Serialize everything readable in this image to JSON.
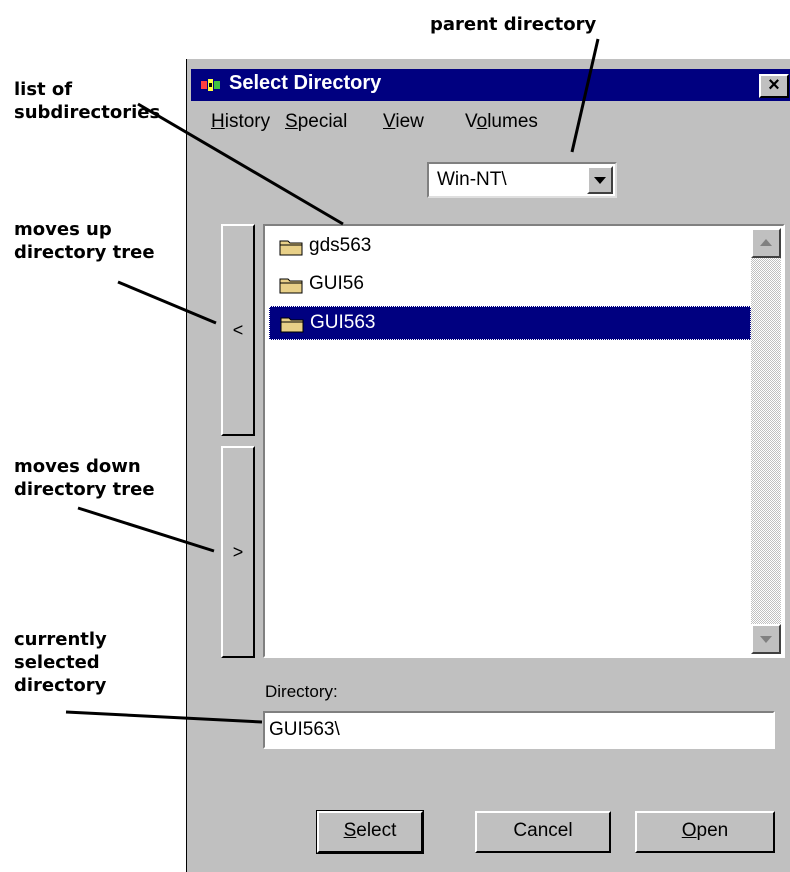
{
  "annotations": {
    "parent_directory": "parent directory",
    "list_of_subdirectories_line1": "list of",
    "list_of_subdirectories_line2": "subdirectories",
    "moves_up_line1": "moves up",
    "moves_up_line2": "directory tree",
    "moves_down_line1": "moves down",
    "moves_down_line2": "directory tree",
    "currently_selected_line1": "currently",
    "currently_selected_line2": "selected",
    "currently_selected_line3": "directory"
  },
  "dialog": {
    "title": "Select Directory",
    "close_label": "×",
    "menu": [
      {
        "underline": "H",
        "rest": "istory"
      },
      {
        "underline": "S",
        "rest": "pecial"
      },
      {
        "underline": "V",
        "rest": "iew"
      },
      {
        "prefix": "V",
        "underline": "o",
        "rest": "lumes"
      }
    ],
    "parent_select_value": "Win-NT\\",
    "up_button_label": "<",
    "down_button_label": ">",
    "directories": [
      {
        "name": "gds563",
        "selected": false
      },
      {
        "name": "GUI56",
        "selected": false
      },
      {
        "name": "GUI563",
        "selected": true
      }
    ],
    "directory_label": "Directory:",
    "directory_value": "GUI563\\",
    "buttons": {
      "select": {
        "underline": "S",
        "rest": "elect"
      },
      "cancel": "Cancel",
      "open": {
        "underline": "O",
        "rest": "pen"
      }
    }
  },
  "colors": {
    "titlebar": "#000080",
    "face": "#c0c0c0",
    "selection": "#000080",
    "folder": "#e8d088"
  }
}
